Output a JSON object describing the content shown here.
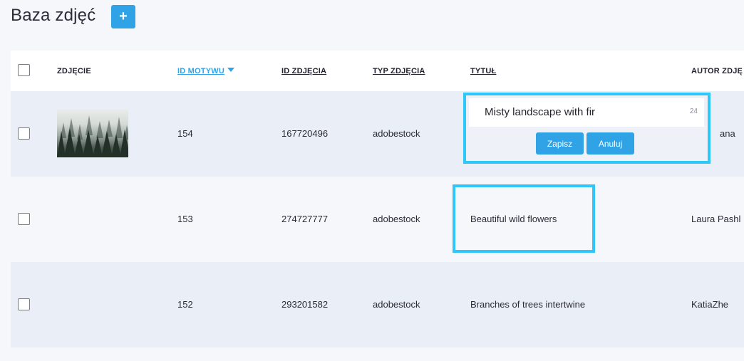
{
  "header": {
    "title": "Baza zdjęć",
    "add_label": "+"
  },
  "table": {
    "columns": {
      "photo": "ZDJĘCIE",
      "motif_id": "ID MOTYWU",
      "photo_id": "ID ZDJĘCIA",
      "photo_type": "TYP ZDJĘCIA",
      "title": "TYTUŁ",
      "author": "AUTOR ZDJĘ"
    },
    "sort": {
      "column": "motif_id",
      "direction": "desc"
    },
    "rows": [
      {
        "motif_id": "154",
        "photo_id": "167720496",
        "photo_type": "adobestock",
        "title": "",
        "author": "ana",
        "has_thumbnail": true
      },
      {
        "motif_id": "153",
        "photo_id": "274727777",
        "photo_type": "adobestock",
        "title": "Beautiful wild flowers",
        "author": "Laura Pashl",
        "has_thumbnail": false
      },
      {
        "motif_id": "152",
        "photo_id": "293201582",
        "photo_type": "adobestock",
        "title": "Branches of trees intertwine",
        "author": "KatiaZhe",
        "has_thumbnail": false
      }
    ]
  },
  "editor": {
    "value": "Misty landscape with fir",
    "char_count": "24",
    "save_label": "Zapisz",
    "cancel_label": "Anuluj"
  },
  "colors": {
    "accent": "#2fa3e6",
    "highlight": "#2ec7f7",
    "row_shade": "#eaeef7"
  }
}
